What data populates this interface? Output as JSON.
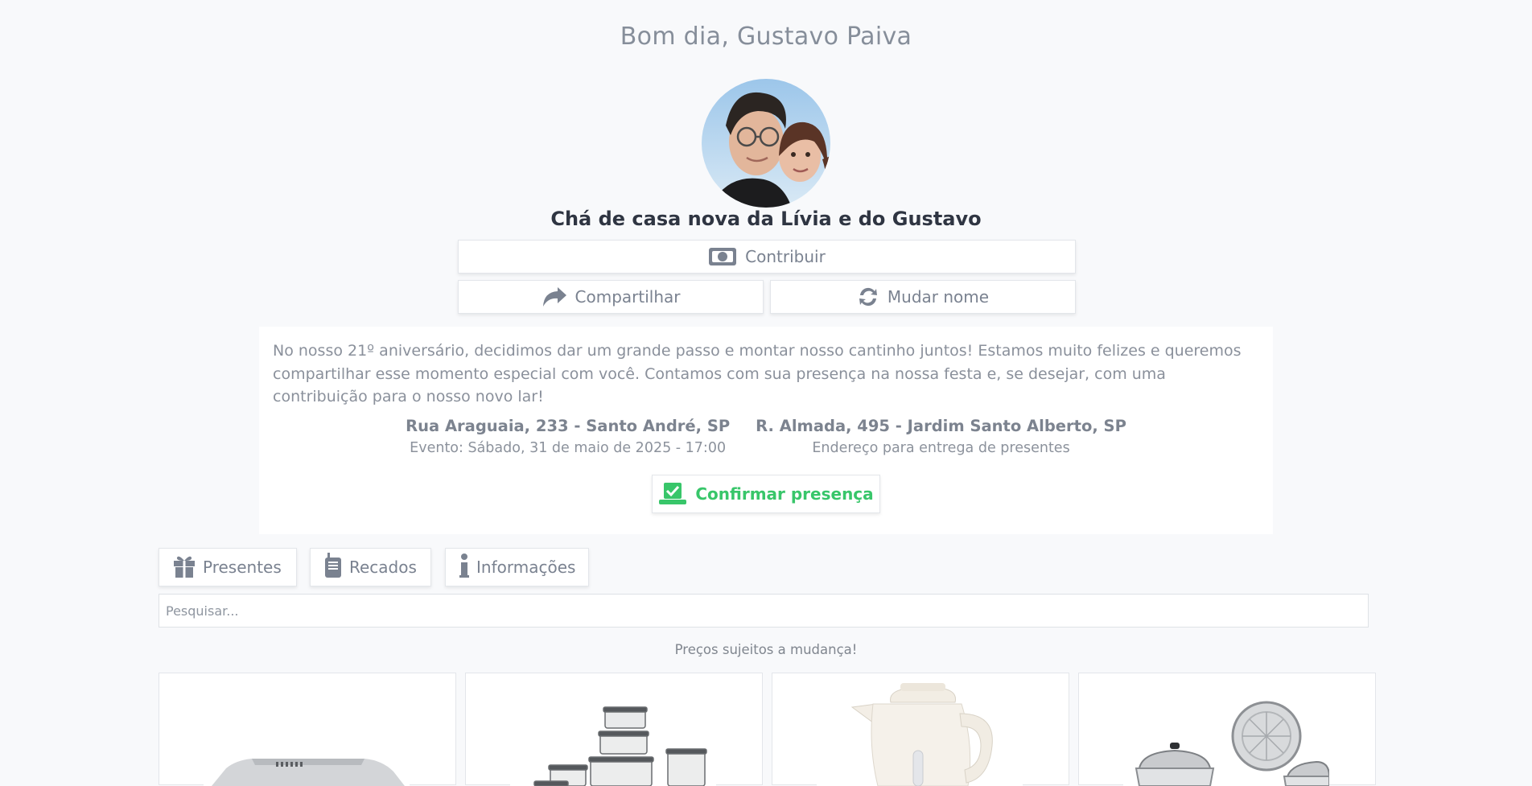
{
  "greeting": "Bom dia, Gustavo Paiva",
  "event_title": "Chá de casa nova da Lívia e do Gustavo",
  "actions": {
    "contribute_label": "Contribuir",
    "share_label": "Compartilhar",
    "rename_label": "Mudar nome"
  },
  "description": "No nosso 21º aniversário, decidimos dar um grande passo e montar nosso cantinho juntos! Estamos muito felizes e queremos compartilhar esse momento especial com você. Contamos com sua presença na nossa festa e, se desejar, com uma contribuição para o nosso novo lar!",
  "addresses": [
    {
      "title": "Rua Araguaia, 233 - Santo André, SP",
      "subtitle": "Evento: Sábado, 31 de maio de 2025 - 17:00"
    },
    {
      "title": "R. Almada, 495 - Jardim Santo Alberto, SP",
      "subtitle": "Endereço para entrega de presentes"
    }
  ],
  "confirm_label": "Confirmar presença",
  "tabs": [
    {
      "label": "Presentes",
      "icon": "gift-icon"
    },
    {
      "label": "Recados",
      "icon": "walkie-talkie-icon"
    },
    {
      "label": "Informações",
      "icon": "info-icon"
    }
  ],
  "search": {
    "placeholder": "Pesquisar..."
  },
  "price_note": "Preços sujeitos a mudança!",
  "products": [
    {
      "icon": "range-hood-image"
    },
    {
      "icon": "food-containers-image"
    },
    {
      "icon": "electric-kettle-image"
    },
    {
      "icon": "cookware-set-image"
    }
  ],
  "colors": {
    "accent_green": "#38c66a",
    "title_dark": "#2f3542",
    "muted": "#7a8290"
  }
}
